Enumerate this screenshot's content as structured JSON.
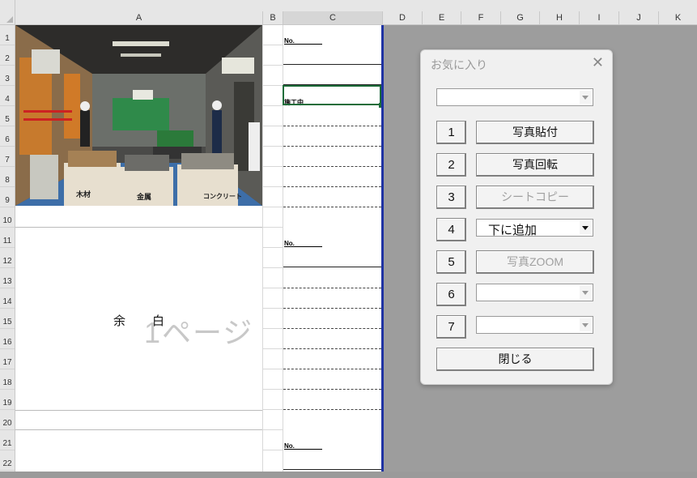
{
  "columns": [
    "A",
    "B",
    "C",
    "D",
    "E",
    "F",
    "G",
    "H",
    "I",
    "J",
    "K"
  ],
  "rows": [
    "1",
    "2",
    "3",
    "4",
    "5",
    "6",
    "7",
    "8",
    "9",
    "10",
    "11",
    "12",
    "13",
    "14",
    "15",
    "16",
    "17",
    "18",
    "19",
    "20",
    "21",
    "22"
  ],
  "cells": {
    "no_label_1": "No.",
    "no_label_2": "No.",
    "no_label_3": "No.",
    "c4_text": "施工中",
    "yohaku_left": "余",
    "yohaku_right": "白",
    "page_watermark": "1ページ"
  },
  "photo": {
    "label_wood": "木材",
    "label_metal": "金属",
    "label_concrete": "コンクリート"
  },
  "dialog": {
    "title": "お気に入り",
    "close_icon": "close-icon",
    "top_combo_value": "",
    "buttons": [
      {
        "num": "1",
        "label": "写真貼付",
        "enabled": true
      },
      {
        "num": "2",
        "label": "写真回転",
        "enabled": true
      },
      {
        "num": "3",
        "label": "シートコピー",
        "enabled": false
      },
      {
        "num": "4",
        "label": "下に追加",
        "kind": "combo"
      },
      {
        "num": "5",
        "label": "写真ZOOM",
        "enabled": false
      },
      {
        "num": "6",
        "label": "",
        "kind": "combo"
      },
      {
        "num": "7",
        "label": "",
        "kind": "combo"
      }
    ],
    "close_label": "閉じる"
  }
}
